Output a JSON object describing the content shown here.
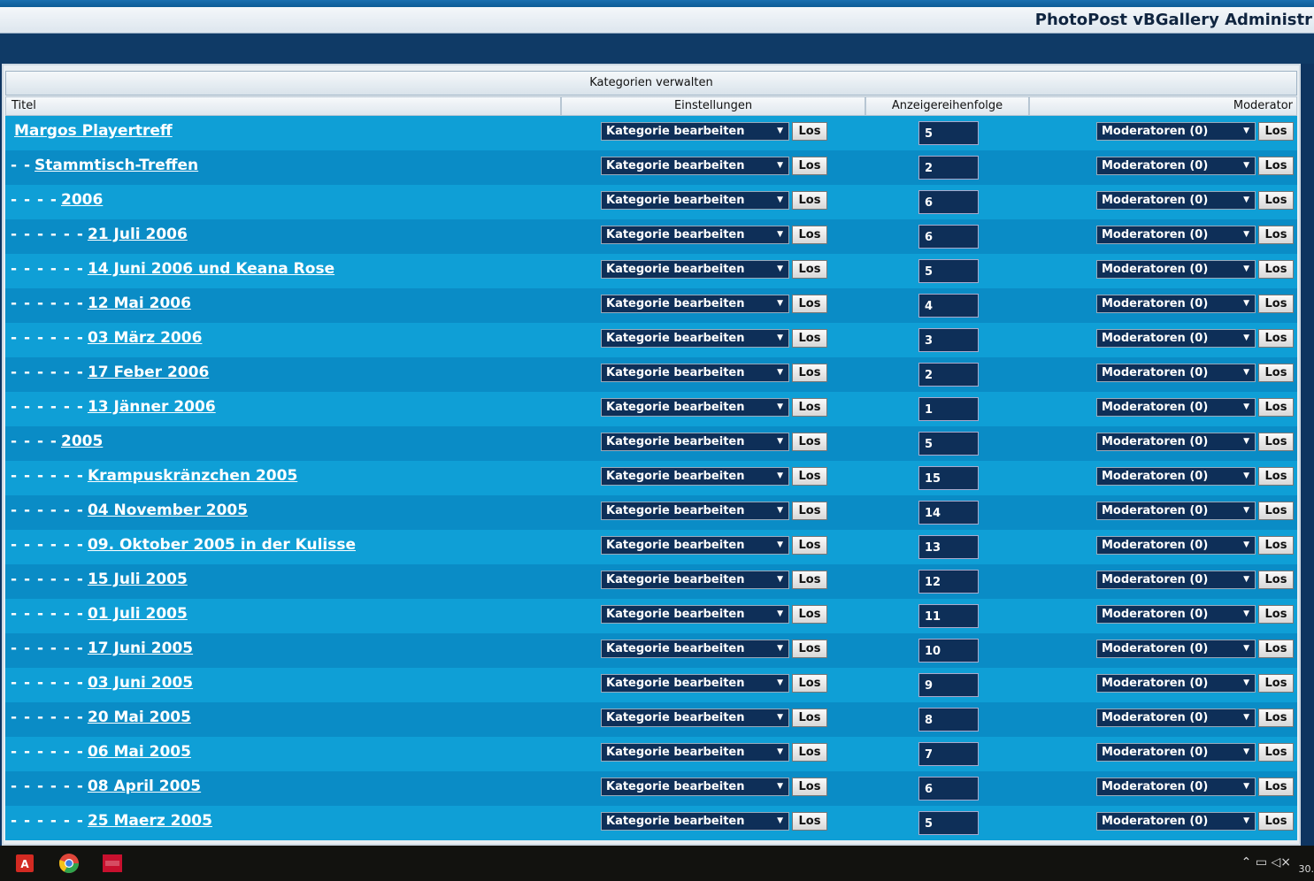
{
  "app": {
    "title": "PhotoPost vBGallery Administr"
  },
  "panel": {
    "title": "Kategorien verwalten",
    "columns": {
      "title": "Titel",
      "settings": "Einstellungen",
      "order": "Anzeigereihenfolge",
      "moderator": "Moderator"
    }
  },
  "category_select": {
    "selected": "Kategorie bearbeiten"
  },
  "moderator_select": {
    "selected": "Moderatoren (0)"
  },
  "go_label": "Los",
  "categories": [
    {
      "prefix": "",
      "name": "Margos Playertreff",
      "order": "5"
    },
    {
      "prefix": "- -",
      "name": "Stammtisch-Treffen",
      "order": "2"
    },
    {
      "prefix": "- - - -",
      "name": "2006",
      "order": "6"
    },
    {
      "prefix": "- - - - - -",
      "name": "21 Juli 2006",
      "order": "6"
    },
    {
      "prefix": "- - - - - -",
      "name": "14 Juni 2006 und Keana Rose",
      "order": "5"
    },
    {
      "prefix": "- - - - - -",
      "name": "12 Mai 2006",
      "order": "4"
    },
    {
      "prefix": "- - - - - -",
      "name": "03 März 2006",
      "order": "3"
    },
    {
      "prefix": "- - - - - -",
      "name": "17 Feber 2006",
      "order": "2"
    },
    {
      "prefix": "- - - - - -",
      "name": "13 Jänner 2006",
      "order": "1"
    },
    {
      "prefix": "- - - -",
      "name": "2005",
      "order": "5"
    },
    {
      "prefix": "- - - - - -",
      "name": "Krampuskränzchen 2005",
      "order": "15"
    },
    {
      "prefix": "- - - - - -",
      "name": "04 November 2005",
      "order": "14"
    },
    {
      "prefix": "- - - - - -",
      "name": "09. Oktober 2005 in der Kulisse",
      "order": "13"
    },
    {
      "prefix": "- - - - - -",
      "name": "15 Juli 2005",
      "order": "12"
    },
    {
      "prefix": "- - - - - -",
      "name": "01 Juli 2005",
      "order": "11"
    },
    {
      "prefix": "- - - - - -",
      "name": "17 Juni 2005",
      "order": "10"
    },
    {
      "prefix": "- - - - - -",
      "name": "03 Juni 2005",
      "order": "9"
    },
    {
      "prefix": "- - - - - -",
      "name": "20 Mai 2005",
      "order": "8"
    },
    {
      "prefix": "- - - - - -",
      "name": "06 Mai 2005",
      "order": "7"
    },
    {
      "prefix": "- - - - - -",
      "name": "08 April 2005",
      "order": "6"
    },
    {
      "prefix": "- - - - - -",
      "name": "25 Maerz 2005",
      "order": "5"
    }
  ],
  "taskbar": {
    "clock": "30."
  },
  "colors": {
    "row_a": "#0f9fd6",
    "row_b": "#0a8cc6",
    "field": "#0e2f58",
    "navbar": "#0f3a66"
  }
}
